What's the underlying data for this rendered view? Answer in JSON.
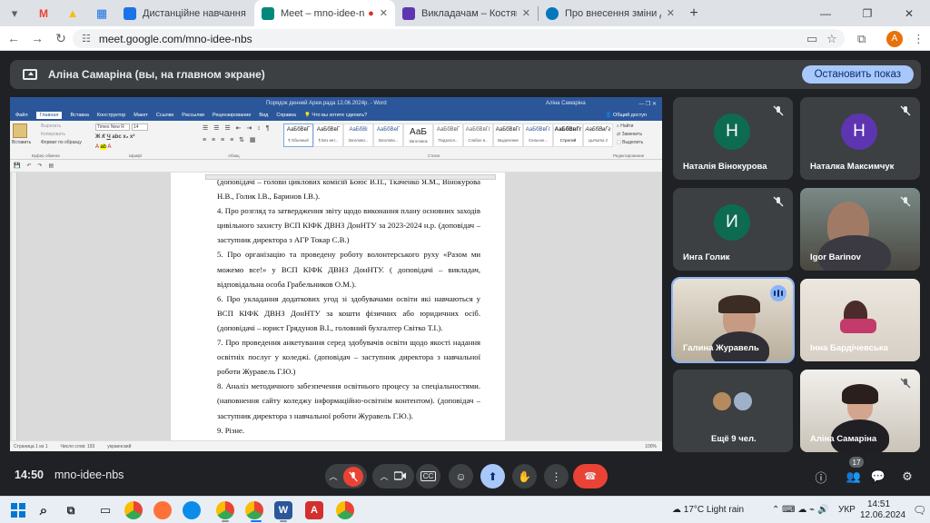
{
  "browser": {
    "tabs": [
      {
        "label": "Дистанційне навчання в ВСП",
        "favicon": "#1a73e8"
      },
      {
        "label": "Meet – mno-idee-nbs",
        "favicon": "#00897b",
        "active": true
      },
      {
        "label": "Викладачам – Костянтинівськ",
        "favicon": "#5e35b1"
      },
      {
        "label": "Про внесення зміни до постан",
        "favicon": "#0277bd"
      }
    ],
    "url": "meet.google.com/mno-idee-nbs",
    "profile_initial": "A"
  },
  "meet": {
    "banner_text": "Аліна Самаріна (вы, на главном экране)",
    "stop_button": "Остановить показ",
    "time": "14:50",
    "meeting_code": "mno-idee-nbs",
    "participant_count": "17",
    "participants": [
      {
        "name": "Наталія Вінокурова",
        "initial": "Н",
        "color": "#0d6b52"
      },
      {
        "name": "Наталка Максимчук",
        "initial": "Н",
        "color": "#5e35b1"
      },
      {
        "name": "Инга Голик",
        "initial": "И",
        "color": "#0d6b52"
      },
      {
        "name": "Igor Barinov"
      },
      {
        "name": "Галина Журавель"
      },
      {
        "name": "Інна Бардічевська"
      },
      {
        "name": "Ещё 9 чел."
      },
      {
        "name": "Аліна Самаріна"
      }
    ]
  },
  "word": {
    "title": "Порядок денний Ареи.рада 12.06.2024р. - Word",
    "user": "Аліна Самаріна",
    "ribbon_tabs": [
      "Файл",
      "Главная",
      "Вставка",
      "Конструктор",
      "Макет",
      "Ссылки",
      "Рассылки",
      "Рецензирование",
      "Вид",
      "Справка"
    ],
    "tell_me": "Что вы хотите сделать?",
    "share": "Общий доступ",
    "font_name": "Times New R",
    "font_size": "14",
    "paste": "Вставить",
    "cut": "Вырезать",
    "copy": "Копировать",
    "format_painter": "Формат по образцу",
    "group_clipboard": "Буфер обмена",
    "group_font": "Шрифт",
    "group_paragraph": "Абзац",
    "group_styles": "Стили",
    "group_editing": "Редактирование",
    "find": "Найти",
    "replace": "Заменить",
    "select": "Выделить",
    "styles": [
      {
        "sample": "АаБбВвГ",
        "name": "¶ Обычный"
      },
      {
        "sample": "АаБбВвГ",
        "name": "¶ Без инт..."
      },
      {
        "sample": "АаБбВі",
        "name": "Заголово..."
      },
      {
        "sample": "АаБбВеГ",
        "name": "Заголово..."
      },
      {
        "sample": "АаБ",
        "name": "Заголовок"
      },
      {
        "sample": "АаБбВвГ",
        "name": "Подзагол..."
      },
      {
        "sample": "АаБбВвГг",
        "name": "Слабое в..."
      },
      {
        "sample": "АаБбВвГг",
        "name": "Выделение"
      },
      {
        "sample": "АаБбВвГг",
        "name": "Сильное..."
      },
      {
        "sample": "АаБбВвГг",
        "name": "Строгий"
      },
      {
        "sample": "АаБбВвГг",
        "name": "Цитата 2"
      }
    ],
    "paragraphs": [
      "(доповідачі – голови циклових комісій Боюс В.П., Ткаченко Я.М., Вінокурова Н.В., Голик І.В., Баринов І.В.).",
      "4. Про розгляд та затвердження звіту щодо виконання плану основних заходів цивільного захисту ВСП КІФК ДВНЗ ДонНТУ за  2023-2024 н.р. (доповідач – заступник директора з АГР Токар С.В.)",
      "5. Про організацію та проведену роботу волонтерського руху «Разом ми можемо все!» у ВСП КІФК ДВНЗ ДонНТУ. ( доповідачі – викладач, відповідальна особа Грабельников О.М.).",
      "6. Про укладання додаткових угод зі здобувачами освіти які навчаються у ВСП КІФК ДВНЗ ДонНТУ за кошти фізичних або юридичних осіб. (доповідачі – юрист Грядунов В.І., головний бухгалтер Світко Т.І.).",
      "7. Про проведення анкетування серед здобувачів освіти щодо якості надання освітніх послуг у коледжі. (доповідач – заступник директора з навчальної роботи Журавель Г.Ю.)",
      "8. Аналіз методичного забезпечення освітнього процесу за спеціальностями. (наповнення сайту коледжу інформаційно-освітнім контентом). (доповідач – заступник директора з навчальної роботи Журавель Г.Ю.).",
      "9. Різне."
    ],
    "status": {
      "page": "Страница 1 из 1",
      "words": "Число слов: 193",
      "lang": "украинский",
      "zoom": "100%"
    }
  },
  "taskbar": {
    "weather": "17°C  Light rain",
    "lang": "УКР",
    "time": "14:51",
    "date": "12.06.2024"
  }
}
